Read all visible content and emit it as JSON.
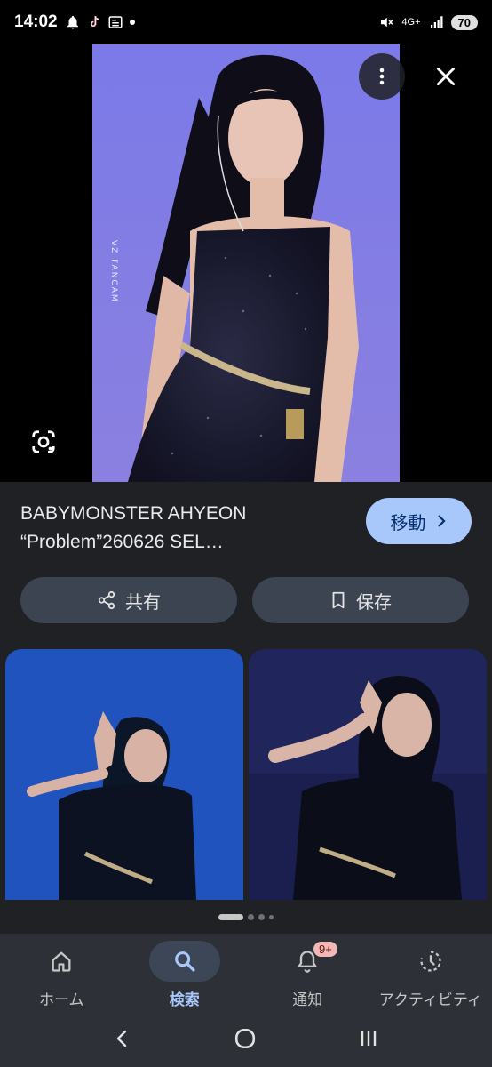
{
  "status_bar": {
    "time": "14:02",
    "network": "4G+",
    "battery": "70"
  },
  "hero": {
    "watermark": "VZ FANCAM",
    "more_icon": "more-vert-icon",
    "close_icon": "close-icon",
    "lens_icon": "lens-icon"
  },
  "result": {
    "title_line1": "BABYMONSTER AHYEON",
    "title_line2": "“Problem”260626 SEL…",
    "visit_label": "移動"
  },
  "actions": {
    "share_label": "共有",
    "save_label": "保存"
  },
  "bottom_nav": {
    "items": [
      {
        "label": "ホーム",
        "icon": "home-icon"
      },
      {
        "label": "検索",
        "icon": "search-icon",
        "active": true
      },
      {
        "label": "通知",
        "icon": "bell-icon",
        "badge": "9+"
      },
      {
        "label": "アクティビティ",
        "icon": "activity-icon"
      }
    ]
  },
  "colors": {
    "accent": "#a8c7fa",
    "background": "#202124",
    "button_bg": "#3c4452"
  }
}
